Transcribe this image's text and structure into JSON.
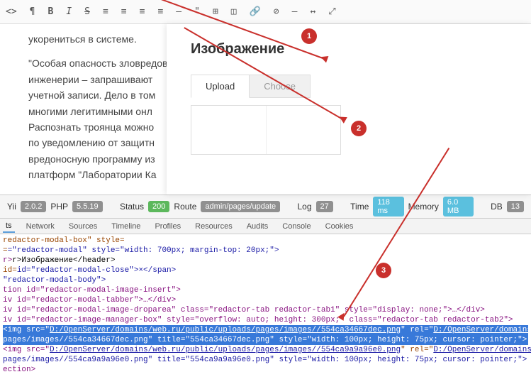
{
  "toolbar": {
    "icons": [
      "<>",
      "¶",
      "B",
      "I",
      "S",
      "≡",
      "≡",
      "≡",
      "≡",
      "–",
      "\"",
      "⊞",
      "◫",
      "🔗",
      "⊘",
      "—",
      "↔",
      "⤢"
    ]
  },
  "article": {
    "p1_tail": "укорениться в системе.",
    "p2": "\"Особая опасность зловредов\nинженерии – запрашивают\nучетной записи. Дело в том\nмногими легитимными онл\nРаспознать троянца можно\nпо уведомлению от защитн\nвредоносную программу из\nплатформ \"Лаборатории Ка"
  },
  "modal": {
    "title": "Изображение",
    "tab_upload": "Upload",
    "tab_choose": "Choose"
  },
  "annotations": {
    "a1": "1",
    "a2": "2",
    "a3": "3"
  },
  "debugbar": {
    "yii_label": "Yii",
    "yii_v": "2.0.2",
    "php_label": "PHP",
    "php_v": "5.5.19",
    "status_label": "Status",
    "status_v": "200",
    "route_label": "Route",
    "route_v": "admin/pages/update",
    "log_label": "Log",
    "log_v": "27",
    "time_label": "Time",
    "time_v": "118 ms",
    "mem_label": "Memory",
    "mem_v": "6.0 MB",
    "db_label": "DB",
    "db_v": "13"
  },
  "devtabs": [
    "ts",
    "Network",
    "Sources",
    "Timeline",
    "Profiles",
    "Resources",
    "Audits",
    "Console",
    "Cookies"
  ],
  "code": {
    "l1": "redactor-modal-box\" style=",
    "l2": "=\"redactor-modal\" style=\"width: 700px; margin-top: 20px;\">",
    "l3": "r>Изображение</header>",
    "l4": "id=\"redactor-modal-close\">×</span>",
    "l5": "\"redactor-modal-body\">",
    "l6": "tion id=\"redactor-modal-image-insert\">",
    "l7": "iv id=\"redactor-modal-tabber\">…</div>",
    "l8": "iv id=\"redactor-modal-image-droparea\" class=\"redactor-tab redactor-tab1\" style=\"display: none;\">…</div>",
    "l9": "iv id=\"redactor-image-manager-box\" style=\"overflow: auto; height: 300px;\" class=\"redactor-tab redactor-tab2\">",
    "l10a": "<img src=\"",
    "l10b": "D:/OpenServer/domains/web.ru/public/uploads/pages/images//554ca34667dec.png",
    "l10c": "\" rel=\"",
    "l10d": "D:/OpenServer/domains/",
    "l11": "pages/images//554ca34667dec.png\" title=\"554ca34667dec.png\" style=\"width: 100px; height: 75px; cursor: pointer;\">",
    "l12a": "<img src=\"",
    "l12b": "D:/OpenServer/domains/web.ru/public/uploads/pages/images//554ca9a9a96e0.png",
    "l12c": "\" rel=\"",
    "l12d": "D:/OpenServer/domains/",
    "l13": "pages/images//554ca9a9a96e0.png\" title=\"554ca9a9a96e0.png\" style=\"width: 100px; height: 75px; cursor: pointer;\">",
    "l14": "ection>"
  }
}
